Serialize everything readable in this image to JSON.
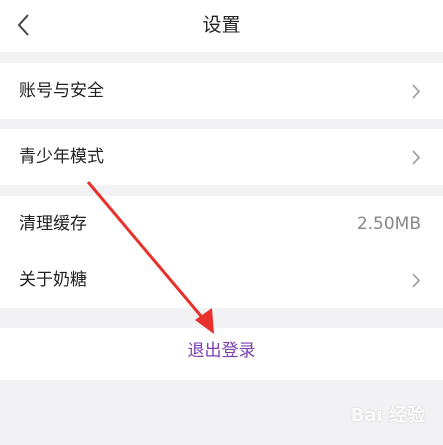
{
  "header": {
    "title": "设置",
    "back_icon": "chevron-left-icon"
  },
  "settings": {
    "account_security": {
      "label": "账号与安全",
      "icon": "chevron-right-icon"
    },
    "teen_mode": {
      "label": "青少年模式",
      "icon": "chevron-right-icon"
    },
    "clear_cache": {
      "label": "清理缓存",
      "value": "2.50MB"
    },
    "about": {
      "label": "关于奶糖",
      "icon": "chevron-right-icon"
    }
  },
  "logout": {
    "label": "退出登录",
    "color": "#7a3fb0"
  },
  "annotation": {
    "arrow_color": "#e8312c"
  },
  "watermark": {
    "text": "Bai 经验"
  }
}
